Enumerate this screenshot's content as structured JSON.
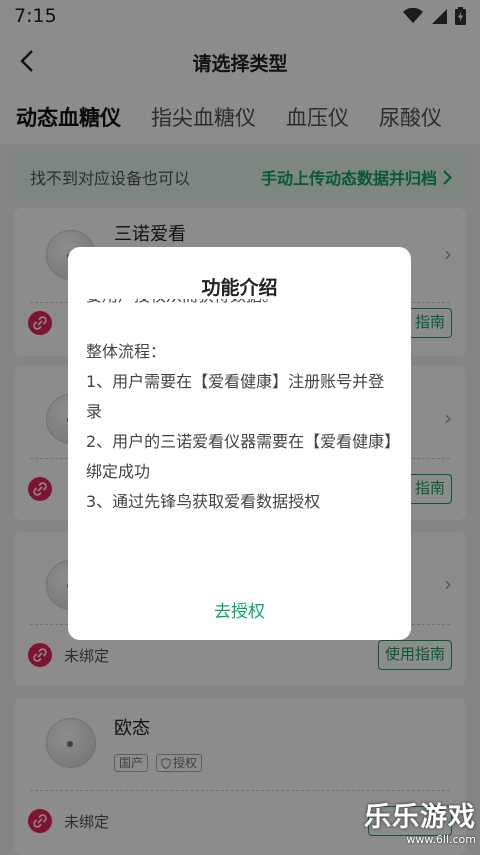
{
  "status_bar": {
    "time": "7:15"
  },
  "header": {
    "title": "请选择类型"
  },
  "tabs": [
    {
      "label": "动态血糖仪",
      "active": true
    },
    {
      "label": "指尖血糖仪",
      "active": false
    },
    {
      "label": "血压仪",
      "active": false
    },
    {
      "label": "尿酸仪",
      "active": false
    }
  ],
  "banner": {
    "text": "找不到对应设备也可以",
    "link_label": "手动上传动态数据并归档"
  },
  "devices": [
    {
      "name": "三诺爱看",
      "status": "",
      "guide_label": "指南"
    },
    {
      "name": "",
      "status": "",
      "guide_label": "指南"
    },
    {
      "name": "",
      "status": "未绑定",
      "guide_label": "使用指南"
    },
    {
      "name": "欧态",
      "tags": [
        "国产",
        "授权"
      ],
      "status": "未绑定",
      "guide_label": ""
    }
  ],
  "dialog": {
    "title": "功能介绍",
    "clipped_text": "要用户授权从而获得数据。",
    "section_title": "整体流程：",
    "steps": [
      "1、用户需要在【爱看健康】注册账号并登录",
      "2、用户的三诺爱看仪器需要在【爱看健康】绑定成功",
      "3、通过先锋鸟获取爱看数据授权"
    ],
    "action_label": "去授权"
  },
  "watermark": {
    "text": "乐乐游戏",
    "url": "www.6ll.com"
  },
  "colors": {
    "accent": "#0ea561",
    "link_red": "#e6265c"
  }
}
